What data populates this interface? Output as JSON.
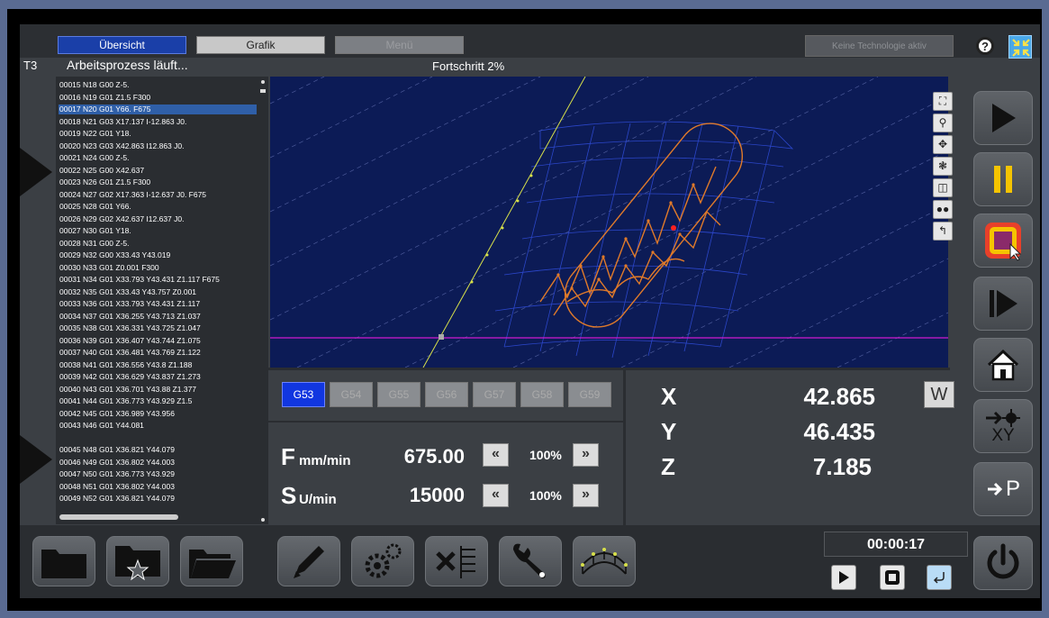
{
  "tabs": [
    {
      "label": "Übersicht",
      "state": "active"
    },
    {
      "label": "Grafik",
      "state": "normal"
    },
    {
      "label": "Menü",
      "state": "disabled"
    }
  ],
  "technology_status": "Keine Technologie aktiv",
  "help_label": "?",
  "tool": "T3",
  "status_text": "Arbeitsprozess läuft...",
  "progress_text": "Fortschritt 2%",
  "progress_percent": 2,
  "code_lines": [
    "00015  N18 G00 Z-5.",
    "00016  N19 G01 Z1.5 F300",
    "00017  N20 G01 Y66. F675",
    "00018  N21 G03 X17.137 I-12.863 J0.",
    "00019  N22 G01 Y18.",
    "00020  N23 G03 X42.863 I12.863 J0.",
    "00021  N24 G00 Z-5.",
    "00022  N25 G00 X42.637",
    "00023  N26 G01 Z1.5 F300",
    "00024  N27 G02 X17.363 I-12.637 J0. F675",
    "00025  N28 G01 Y66.",
    "00026  N29 G02 X42.637 I12.637 J0.",
    "00027  N30 G01 Y18.",
    "00028  N31 G00 Z-5.",
    "00029  N32 G00 X33.43 Y43.019",
    "00030  N33 G01 Z0.001 F300",
    "00031  N34 G01 X33.793 Y43.431 Z1.117 F675",
    "00032  N35 G01 X33.43 Y43.757 Z0.001",
    "00033  N36 G01 X33.793 Y43.431 Z1.117",
    "00034  N37 G01 X36.255 Y43.713 Z1.037",
    "00035  N38 G01 X36.331 Y43.725 Z1.047",
    "00036  N39 G01 X36.407 Y43.744 Z1.075",
    "00037  N40 G01 X36.481 Y43.769 Z1.122",
    "00038  N41 G01 X36.556 Y43.8 Z1.188",
    "00039  N42 G01 X36.629 Y43.837 Z1.273",
    "00040  N43 G01 X36.701 Y43.88 Z1.377",
    "00041  N44 G01 X36.773 Y43.929 Z1.5",
    "00042  N45 G01 X36.989 Y43.956",
    "00043  N46 G01 Y44.081",
    "",
    "00045  N48 G01 X36.821 Y44.079",
    "00046  N49 G01 X36.802 Y44.003",
    "00047  N50 G01 X36.773 Y43.929",
    "00048  N51 G01 X36.802 Y44.003",
    "00049  N52 G01 X36.821 Y44.079"
  ],
  "selected_line_index": 2,
  "graphic_tools": [
    "fit-view-icon",
    "zoom-icon",
    "pan-icon",
    "rotate-icon",
    "3d-view-icon",
    "glasses-icon",
    "back-icon"
  ],
  "work_offsets": [
    "G53",
    "G54",
    "G55",
    "G56",
    "G57",
    "G58",
    "G59"
  ],
  "active_offset": "G53",
  "feed": {
    "letter": "F",
    "unit": "mm/min",
    "value": "675.00",
    "override": "100%"
  },
  "spindle": {
    "letter": "S",
    "unit": "U/min",
    "value": "15000",
    "override": "100%"
  },
  "override_dec": "«",
  "override_inc": "»",
  "coords": [
    {
      "axis": "X",
      "value": "42.865"
    },
    {
      "axis": "Y",
      "value": "46.435"
    },
    {
      "axis": "Z",
      "value": "7.185"
    }
  ],
  "coord_mode": "W",
  "right_buttons": [
    "start-icon",
    "pause-icon",
    "stop-icon",
    "step-icon",
    "home-icon",
    "move-to-xy-icon",
    "move-to-p-icon"
  ],
  "move_xy_label": "XY",
  "move_p_label": "P",
  "bottom_buttons": [
    "folder-icon",
    "folder-favorites-icon",
    "folder-open-icon",
    "edit-icon",
    "settings-icon",
    "tool-table-icon",
    "wrench-icon",
    "surface-icon"
  ],
  "timer": "00:00:17",
  "colors": {
    "accent": "#1a3fa8",
    "graphic_bg": "#0c1b56",
    "path_orange": "#e07a2a",
    "pause_yellow": "#f5c400",
    "stop_red": "#e8402a"
  }
}
